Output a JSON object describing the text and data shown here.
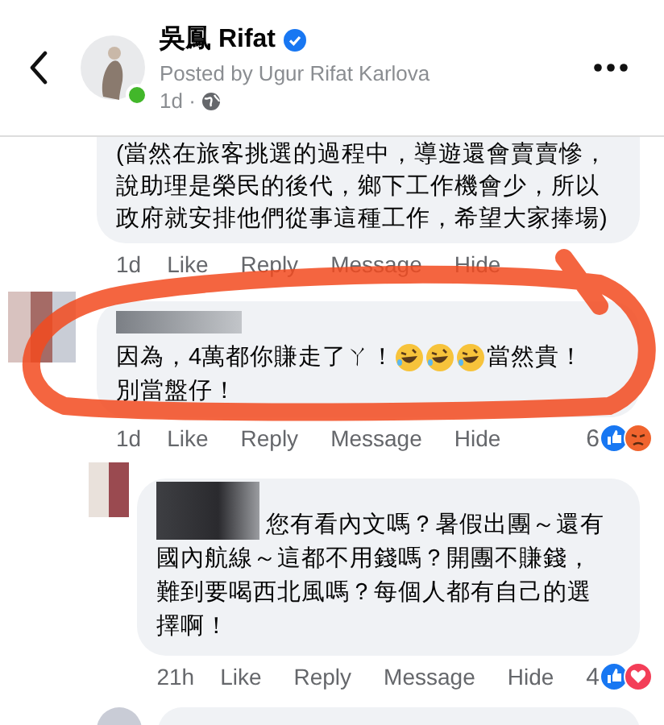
{
  "header": {
    "name": "吳鳳 Rifat",
    "verified": true,
    "online": true,
    "subtitle": "Posted by Ugur Rifat Karlova",
    "time": "1d ·"
  },
  "comments": [
    {
      "kind": "cut",
      "lines": [
        [
          {
            "kind": "text",
            "text": "(當然在旅客挑選的過程中，導遊還會賣賣慘，"
          }
        ],
        [
          {
            "kind": "text",
            "text": "說助理是榮民的後代，鄉下工作機會少，所以"
          }
        ],
        [
          {
            "kind": "text",
            "text": "政府就安排他們從事這種工作，希望大家捧場)"
          }
        ]
      ],
      "time": "1d",
      "actions": [
        "Like",
        "Reply",
        "Message",
        "Hide"
      ]
    },
    {
      "kind": "comment",
      "lines": [
        [
          {
            "kind": "text",
            "text": "因為，4萬都你賺走了ㄚ！"
          },
          {
            "kind": "emoji"
          },
          {
            "kind": "emoji"
          },
          {
            "kind": "emoji"
          },
          {
            "kind": "text",
            "text": "當然貴！"
          }
        ],
        [
          {
            "kind": "text",
            "text": "別當盤仔！"
          }
        ]
      ],
      "time": "1d",
      "actions": [
        "Like",
        "Reply",
        "Message",
        "Hide"
      ],
      "reaction_count": "6",
      "reactions": [
        {
          "kind": "like"
        },
        {
          "kind": "angry"
        }
      ]
    },
    {
      "kind": "reply",
      "lines": [
        [
          {
            "kind": "text",
            "text": "您有看內文嗎？暑假出團～還有"
          }
        ],
        [
          {
            "kind": "text",
            "text": "國內航線～這都不用錢嗎？開團不賺錢，"
          }
        ],
        [
          {
            "kind": "text",
            "text": "難到要喝西北風嗎？每個人都有自己的選"
          }
        ],
        [
          {
            "kind": "text",
            "text": "擇啊！"
          }
        ]
      ],
      "time": "21h",
      "actions": [
        "Like",
        "Reply",
        "Message",
        "Hide"
      ],
      "reaction_count": "4",
      "reactions": [
        {
          "kind": "like"
        },
        {
          "kind": "love"
        }
      ]
    }
  ]
}
